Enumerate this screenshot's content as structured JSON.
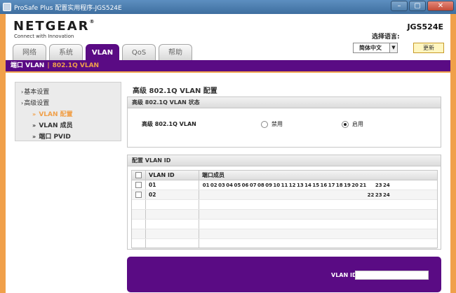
{
  "window": {
    "title": "ProSafe Plus 配置实用程序-JGS524E",
    "min": "–",
    "max": "▢",
    "close": "✕"
  },
  "header": {
    "brand": "NETGEAR",
    "tagline": "Connect with Innovation",
    "model": "JGS524E",
    "language_label": "选择语言:",
    "language_value": "简体中文",
    "apply_label": "更新"
  },
  "tabs": [
    {
      "label": "网络",
      "active": false
    },
    {
      "label": "系统",
      "active": false
    },
    {
      "label": "VLAN",
      "active": true
    },
    {
      "label": "QoS",
      "active": false
    },
    {
      "label": "帮助",
      "active": false
    }
  ],
  "subtabs": {
    "item1": "端口 VLAN",
    "item2": "802.1Q VLAN"
  },
  "sidebar": {
    "items": [
      {
        "label": "基本设置",
        "level": 1
      },
      {
        "label": "高级设置",
        "level": 1
      },
      {
        "label": "VLAN 配置",
        "level": 2,
        "active": true
      },
      {
        "label": "VLAN 成员",
        "level": 2
      },
      {
        "label": "端口 PVID",
        "level": 2
      }
    ]
  },
  "main": {
    "title": "高级 802.1Q VLAN 配置",
    "status_panel": {
      "title": "高级 802.1Q VLAN 状态",
      "label": "高级 802.1Q VLAN",
      "option_disabled": "禁用",
      "option_enabled": "启用",
      "selected": "启用"
    },
    "table_panel": {
      "title": "配置 VLAN ID",
      "col_id": "VLAN ID",
      "col_ports": "端口成员",
      "rows": [
        {
          "vlan_id": "01",
          "ports": [
            "01",
            "02",
            "03",
            "04",
            "05",
            "06",
            "07",
            "08",
            "09",
            "10",
            "11",
            "12",
            "13",
            "14",
            "15",
            "16",
            "17",
            "18",
            "19",
            "20",
            "21",
            "",
            "23",
            "24"
          ]
        },
        {
          "vlan_id": "02",
          "ports": [
            "",
            "",
            "",
            "",
            "",
            "",
            "",
            "",
            "",
            "",
            "",
            "",
            "",
            "",
            "",
            "",
            "",
            "",
            "",
            "",
            "",
            "22",
            "23",
            "24"
          ]
        }
      ]
    },
    "form": {
      "vlan_id_label": "VLAN ID",
      "vlan_id_value": ""
    }
  }
}
